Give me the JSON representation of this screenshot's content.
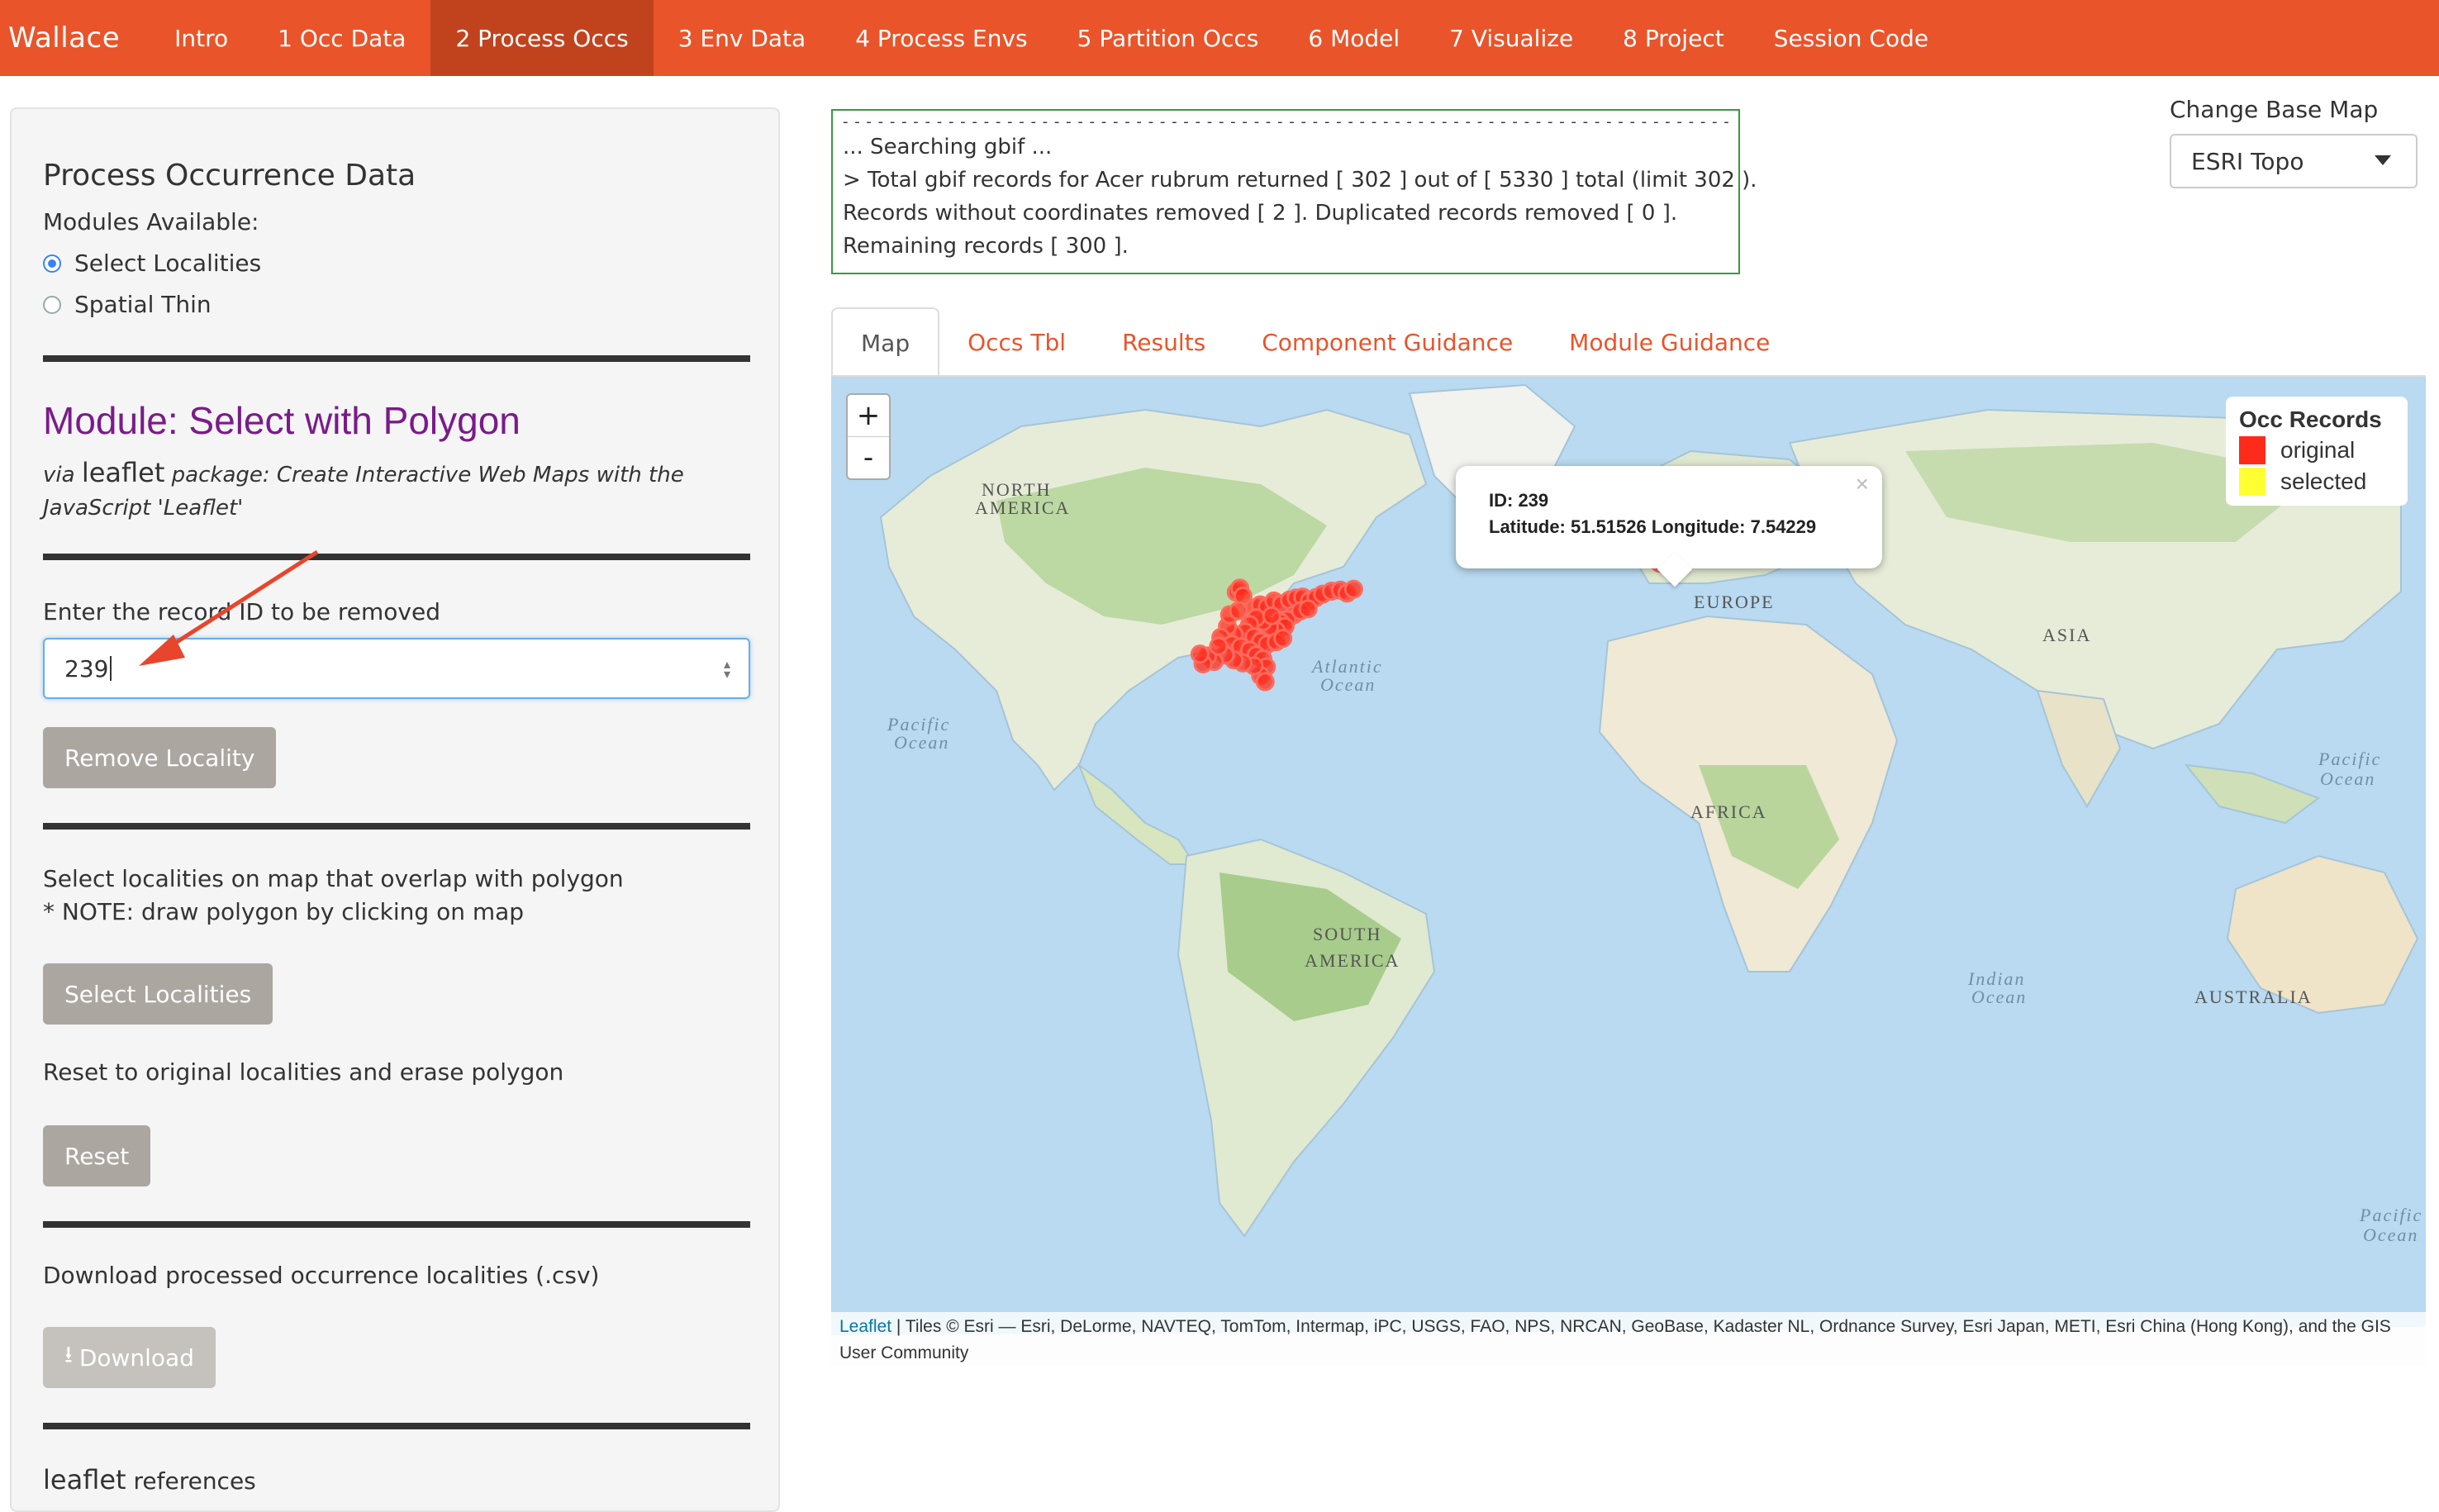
{
  "navbar": {
    "brand": "Wallace",
    "items": [
      "Intro",
      "1 Occ Data",
      "2 Process Occs",
      "3 Env Data",
      "4 Process Envs",
      "5 Partition Occs",
      "6 Model",
      "7 Visualize",
      "8 Project",
      "Session Code"
    ],
    "active_index": 2
  },
  "sidebar": {
    "section_title": "Process Occurrence Data",
    "modules_label": "Modules Available:",
    "modules": [
      {
        "label": "Select Localities",
        "selected": true
      },
      {
        "label": "Spatial Thin",
        "selected": false
      }
    ],
    "module_title": "Module: Select with Polygon",
    "via_prefix": "via",
    "package_name": "leaflet",
    "package_desc": "package: Create Interactive Web Maps with the JavaScript 'Leaflet'",
    "remove_label": "Enter the record ID to be removed",
    "remove_value": "239",
    "remove_button": "Remove Locality",
    "select_text_1": "Select localities on map that overlap with polygon",
    "select_text_2": "* NOTE: draw polygon by clicking on map",
    "select_button": "Select Localities",
    "reset_text": "Reset to original localities and erase polygon",
    "reset_button": "Reset",
    "download_text": "Download processed occurrence localities (.csv)",
    "download_button": "Download",
    "references_pkg": "leaflet",
    "references_text": "references"
  },
  "console": {
    "lines": [
      "... Searching gbif ...",
      "> Total gbif records for Acer rubrum returned [ 302 ] out of [ 5330 ] total (limit 302 ).",
      "Records without coordinates removed [ 2 ]. Duplicated records removed [ 0 ].",
      "Remaining records [ 300 ]."
    ]
  },
  "basemap": {
    "label": "Change Base Map",
    "selected": "ESRI Topo"
  },
  "tabs": [
    "Map",
    "Occs Tbl",
    "Results",
    "Component Guidance",
    "Module Guidance"
  ],
  "map": {
    "zoom_in": "+",
    "zoom_out": "-",
    "legend_title": "Occ Records",
    "legend_items": [
      {
        "label": "original",
        "color": "#ff2a1a"
      },
      {
        "label": "selected",
        "color": "#ffff33"
      }
    ],
    "popup_id": "ID: 239",
    "popup_coords": "Latitude: 51.51526 Longitude: 7.54229",
    "labels": {
      "north_america_1": "NORTH",
      "north_america_2": "AMERICA",
      "south_america_1": "SOUTH",
      "south_america_2": "AMERICA",
      "europe": "EUROPE",
      "asia": "ASIA",
      "africa": "AFRICA",
      "australia": "AUSTRALIA",
      "atlantic_1": "Atlantic",
      "atlantic_2": "Ocean",
      "pacific_w_1": "Pacific",
      "pacific_w_2": "Ocean",
      "pacific_e_1": "Pacific",
      "pacific_e_2": "Ocean",
      "indian_1": "Indian",
      "indian_2": "Ocean",
      "pacific_se_1": "Pacific",
      "pacific_se_2": "Ocean"
    },
    "occurrences": [
      {
        "lon": -88.0,
        "lat": 45.6
      },
      {
        "lon": -87.2,
        "lat": 46.4
      },
      {
        "lon": -86.5,
        "lat": 44.8
      },
      {
        "lon": -84.0,
        "lat": 42.4
      },
      {
        "lon": -82.6,
        "lat": 43.0
      },
      {
        "lon": -81.0,
        "lat": 42.6
      },
      {
        "lon": -79.5,
        "lat": 43.8
      },
      {
        "lon": -77.8,
        "lat": 43.2
      },
      {
        "lon": -76.0,
        "lat": 44.0
      },
      {
        "lon": -74.5,
        "lat": 44.4
      },
      {
        "lon": -73.0,
        "lat": 44.6
      },
      {
        "lon": -71.5,
        "lat": 43.8
      },
      {
        "lon": -70.0,
        "lat": 44.5
      },
      {
        "lon": -68.5,
        "lat": 45.2
      },
      {
        "lon": -66.5,
        "lat": 45.8
      },
      {
        "lon": -64.5,
        "lat": 46.0
      },
      {
        "lon": -63.0,
        "lat": 45.4
      },
      {
        "lon": -61.5,
        "lat": 46.2
      },
      {
        "lon": -75.0,
        "lat": 41.0
      },
      {
        "lon": -76.5,
        "lat": 40.0
      },
      {
        "lon": -78.0,
        "lat": 39.5
      },
      {
        "lon": -77.0,
        "lat": 38.6
      },
      {
        "lon": -79.0,
        "lat": 37.8
      },
      {
        "lon": -80.5,
        "lat": 38.5
      },
      {
        "lon": -82.0,
        "lat": 39.6
      },
      {
        "lon": -83.5,
        "lat": 40.4
      },
      {
        "lon": -85.0,
        "lat": 39.0
      },
      {
        "lon": -86.0,
        "lat": 37.5
      },
      {
        "lon": -84.0,
        "lat": 36.5
      },
      {
        "lon": -82.5,
        "lat": 35.6
      },
      {
        "lon": -81.0,
        "lat": 35.0
      },
      {
        "lon": -79.0,
        "lat": 35.5
      },
      {
        "lon": -77.5,
        "lat": 36.2
      },
      {
        "lon": -88.5,
        "lat": 37.0
      },
      {
        "lon": -90.0,
        "lat": 38.6
      },
      {
        "lon": -91.5,
        "lat": 36.4
      },
      {
        "lon": -89.0,
        "lat": 35.0
      },
      {
        "lon": -87.0,
        "lat": 34.5
      },
      {
        "lon": -85.0,
        "lat": 33.8
      },
      {
        "lon": -83.5,
        "lat": 32.8
      },
      {
        "lon": -82.0,
        "lat": 32.0
      },
      {
        "lon": -81.2,
        "lat": 30.4
      },
      {
        "lon": -82.5,
        "lat": 28.6
      },
      {
        "lon": -81.5,
        "lat": 27.4
      },
      {
        "lon": -84.0,
        "lat": 30.6
      },
      {
        "lon": -86.5,
        "lat": 31.2
      },
      {
        "lon": -88.5,
        "lat": 31.8
      },
      {
        "lon": -90.5,
        "lat": 32.8
      },
      {
        "lon": -93.0,
        "lat": 31.5
      },
      {
        "lon": -94.5,
        "lat": 32.6
      },
      {
        "lon": -95.5,
        "lat": 31.0
      },
      {
        "lon": -96.2,
        "lat": 33.0
      },
      {
        "lon": -92.0,
        "lat": 34.6
      },
      {
        "lon": -89.5,
        "lat": 41.0
      },
      {
        "lon": -87.5,
        "lat": 41.8
      },
      {
        "lon": -73.5,
        "lat": 41.8
      },
      {
        "lon": -71.8,
        "lat": 42.2
      },
      {
        "lon": -80.0,
        "lat": 40.8
      },
      {
        "lon": 7.54229,
        "lat": 51.51526
      }
    ],
    "attribution_link": "Leaflet",
    "attribution_text": " | Tiles © Esri — Esri, DeLorme, NAVTEQ, TomTom, Intermap, iPC, USGS, FAO, NPS, NRCAN, GeoBase, Kadaster NL, Ordnance Survey, Esri Japan, METI, Esri China (Hong Kong), and the GIS User Community"
  },
  "colors": {
    "brand": "#e9542a",
    "brand_active": "#c1431e",
    "module_title": "#7a1b8a",
    "ocean": "#b9daf0",
    "land": "#e7ecd8",
    "forest": "#bcd8a3",
    "occurrence": "#ff2a1a"
  }
}
